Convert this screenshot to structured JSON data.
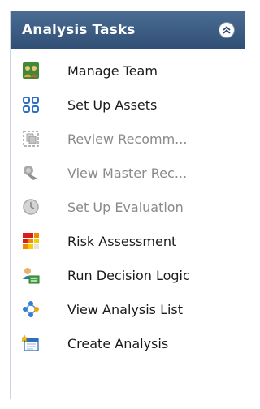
{
  "panel": {
    "title": "Analysis Tasks",
    "collapse_icon": "double-chevron-up-icon"
  },
  "tasks": [
    {
      "label": "Manage Team",
      "icon": "team-icon",
      "enabled": true
    },
    {
      "label": "Set Up Assets",
      "icon": "assets-grid-icon",
      "enabled": true
    },
    {
      "label": "Review Recomm...",
      "icon": "review-recommendations-icon",
      "enabled": false
    },
    {
      "label": "View Master Rec...",
      "icon": "master-record-icon",
      "enabled": false
    },
    {
      "label": "Set Up Evaluation",
      "icon": "evaluation-clock-icon",
      "enabled": false
    },
    {
      "label": "Risk Assessment",
      "icon": "risk-matrix-icon",
      "enabled": true
    },
    {
      "label": "Run Decision Logic",
      "icon": "decision-logic-icon",
      "enabled": true
    },
    {
      "label": "View Analysis List",
      "icon": "analysis-list-icon",
      "enabled": true
    },
    {
      "label": "Create Analysis",
      "icon": "create-analysis-icon",
      "enabled": true
    }
  ]
}
